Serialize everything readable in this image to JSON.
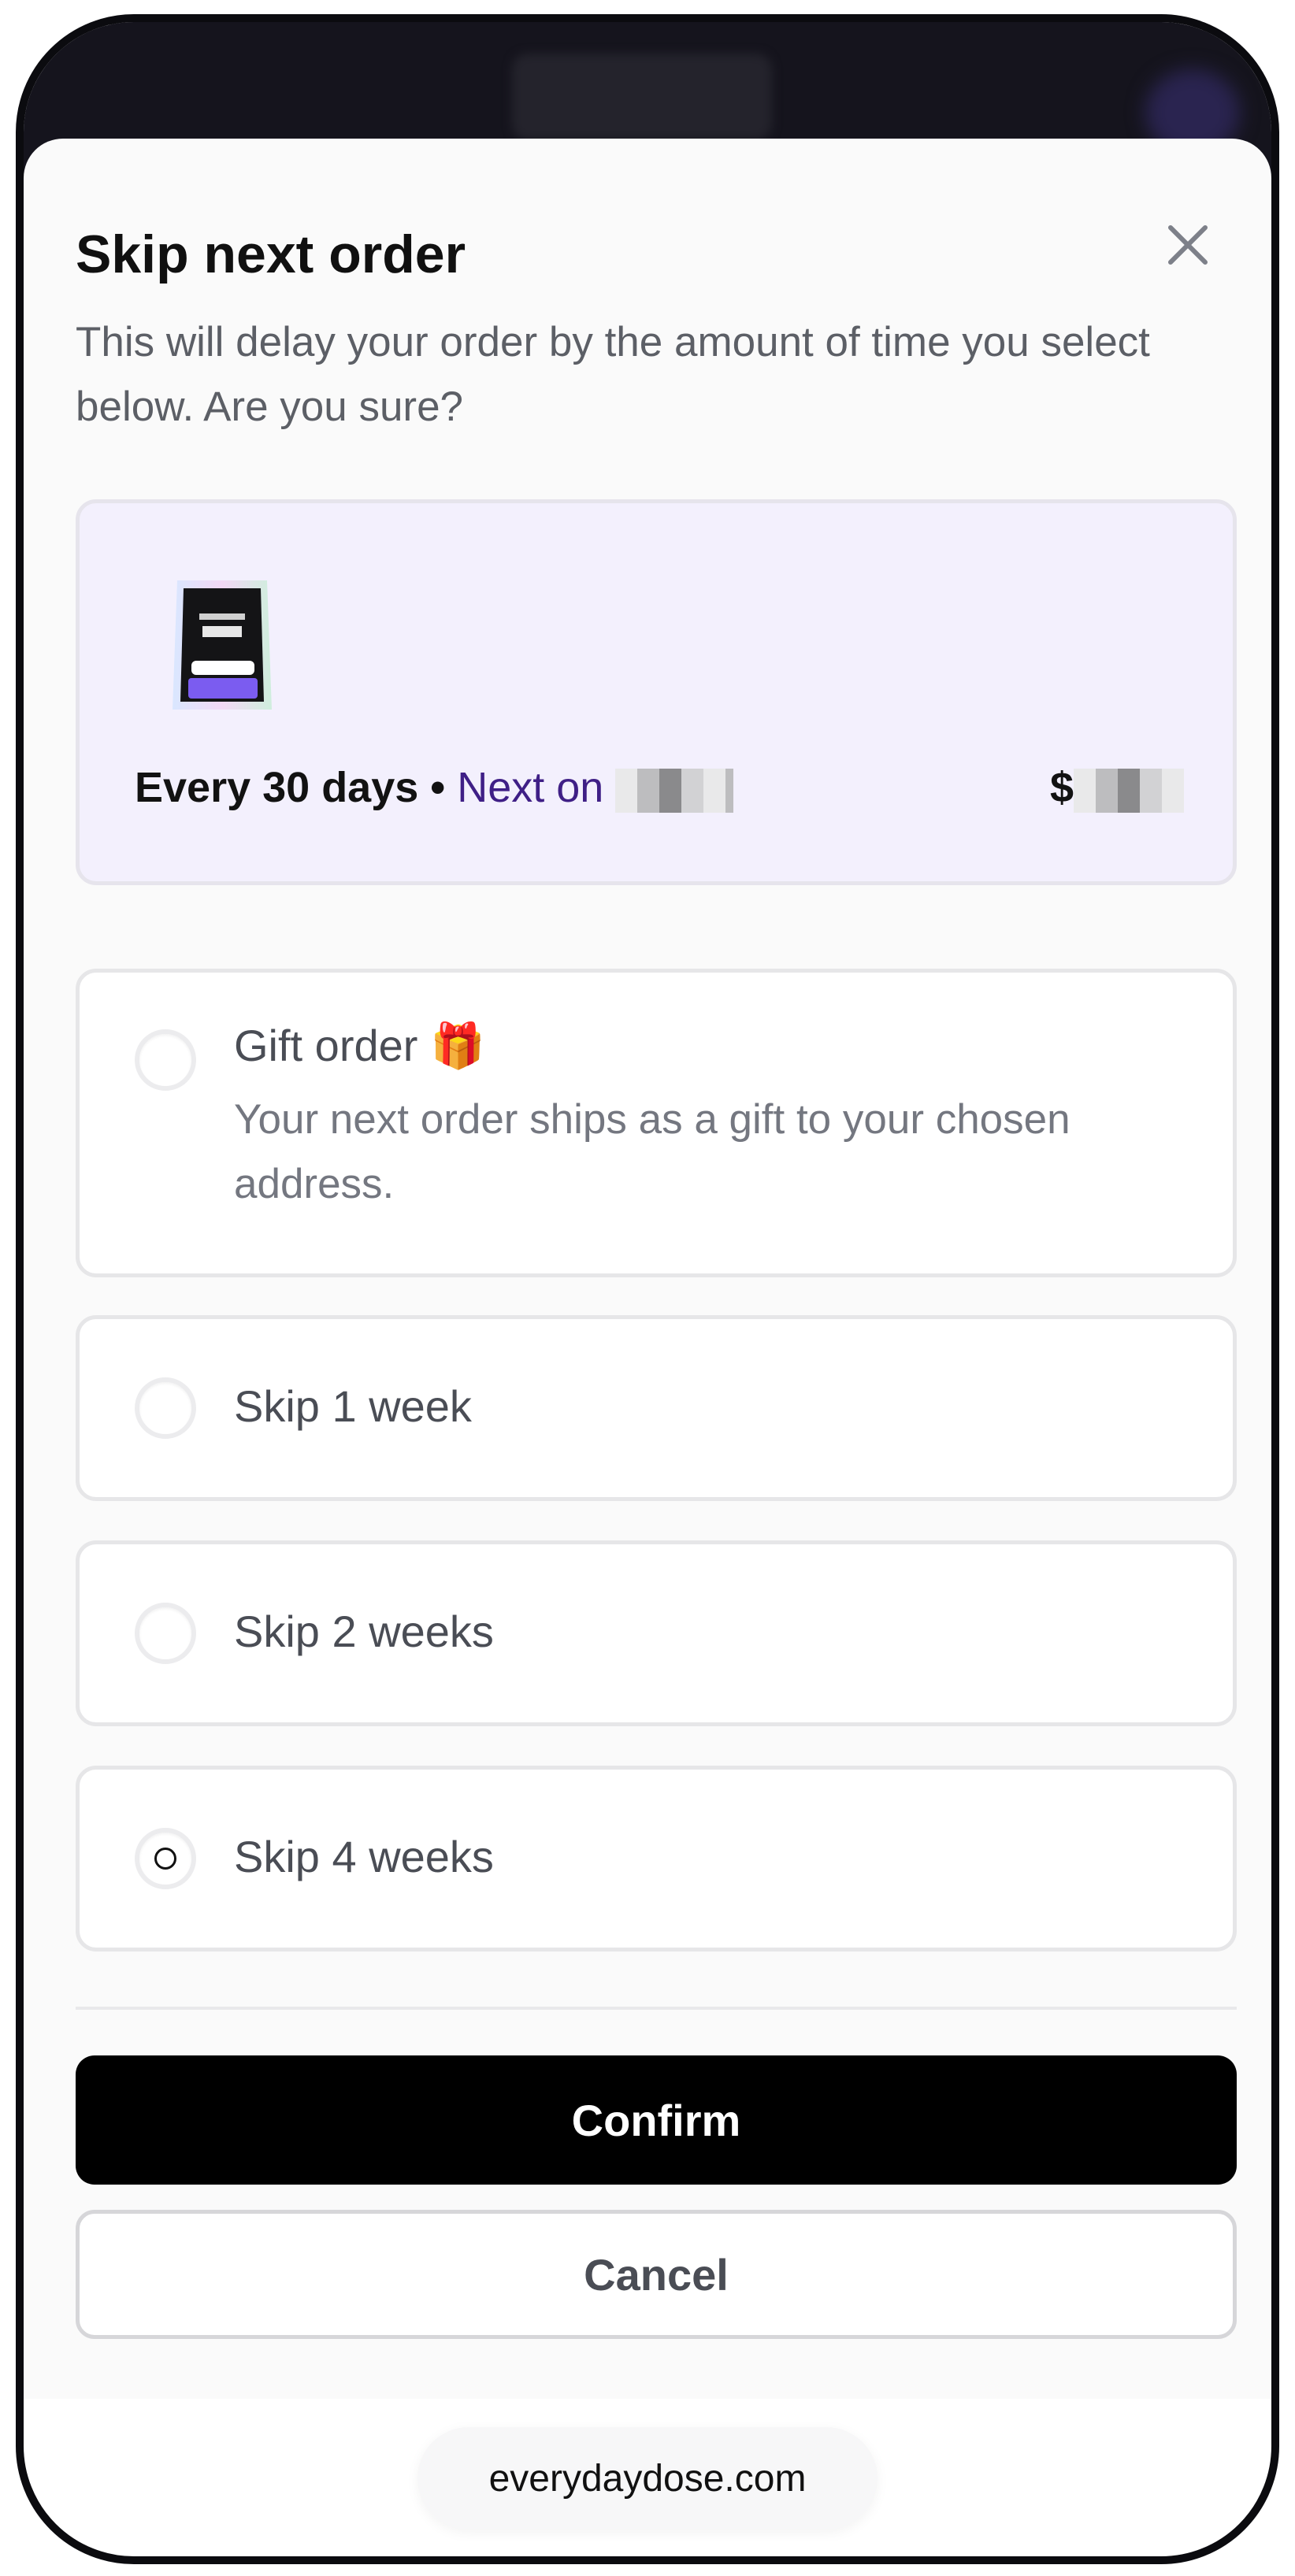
{
  "modal": {
    "title": "Skip next order",
    "subtitle": "This will delay your order by the amount of time you select below. Are you sure?",
    "close_icon": "close-icon"
  },
  "subscription": {
    "frequency": "Every 30 days",
    "separator": " • ",
    "next_label": "Next on ",
    "currency": "$"
  },
  "options": {
    "gift": {
      "label": "Gift order",
      "emoji": "🎁",
      "description": "Your next order ships as a gift to your chosen address."
    },
    "skip1": {
      "label": "Skip 1 week"
    },
    "skip2": {
      "label": "Skip 2 weeks"
    },
    "skip4": {
      "label": "Skip 4 weeks"
    },
    "selected": "skip4"
  },
  "actions": {
    "confirm": "Confirm",
    "cancel": "Cancel"
  },
  "browser": {
    "url": "everydaydose.com"
  },
  "colors": {
    "accent_purple": "#3f1f86",
    "card_bg": "#f3f0fd",
    "confirm_bg": "#000000"
  }
}
